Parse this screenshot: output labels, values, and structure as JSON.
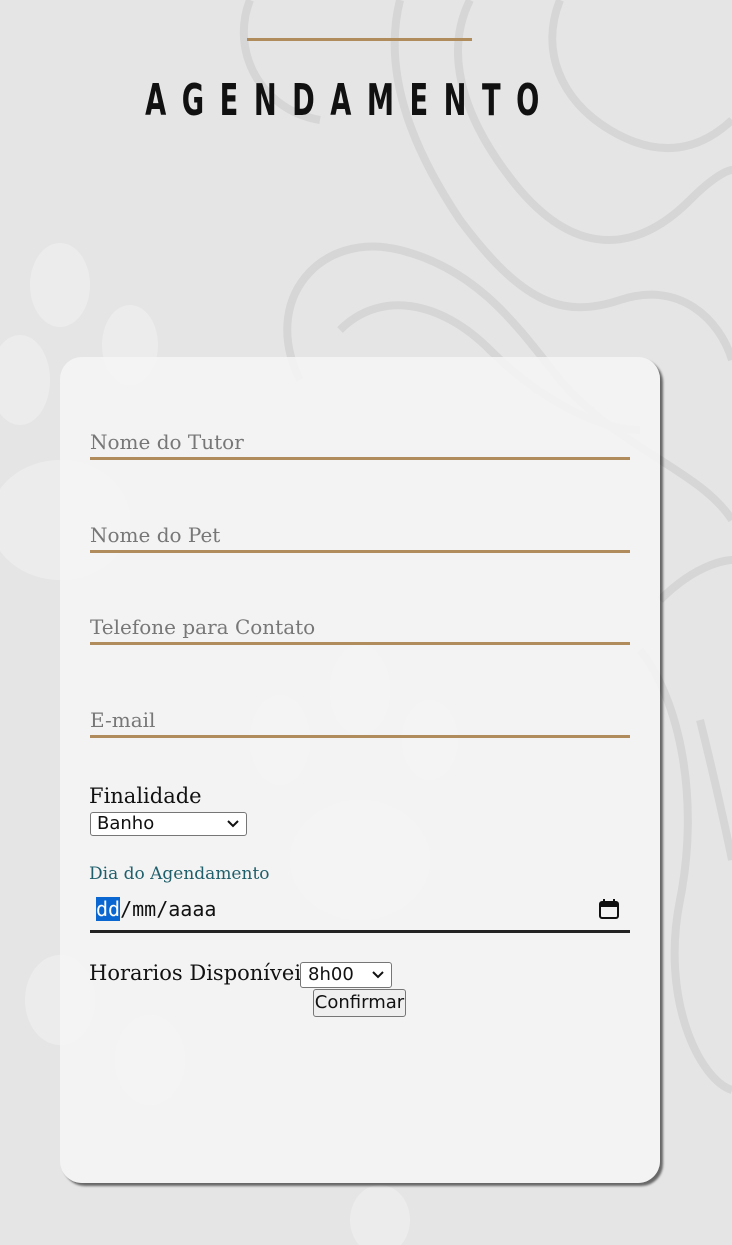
{
  "header": {
    "title": "AGENDAMENTO"
  },
  "form": {
    "tutor_placeholder": "Nome do Tutor",
    "pet_placeholder": "Nome do Pet",
    "phone_placeholder": "Telefone para Contato",
    "email_placeholder": "E-mail",
    "finalidade_label": "Finalidade",
    "finalidade_value": "Banho",
    "date_label": "Dia do Agendamento",
    "date_dd": "dd",
    "date_rest": "/mm/aaaa",
    "horarios_label": "Horarios Disponíveis",
    "horario_value": "8h00",
    "confirm_label": "Confirmar"
  },
  "colors": {
    "accent": "#b08c5c",
    "date_label": "#1f5f6b",
    "background": "#e5e5e5"
  }
}
